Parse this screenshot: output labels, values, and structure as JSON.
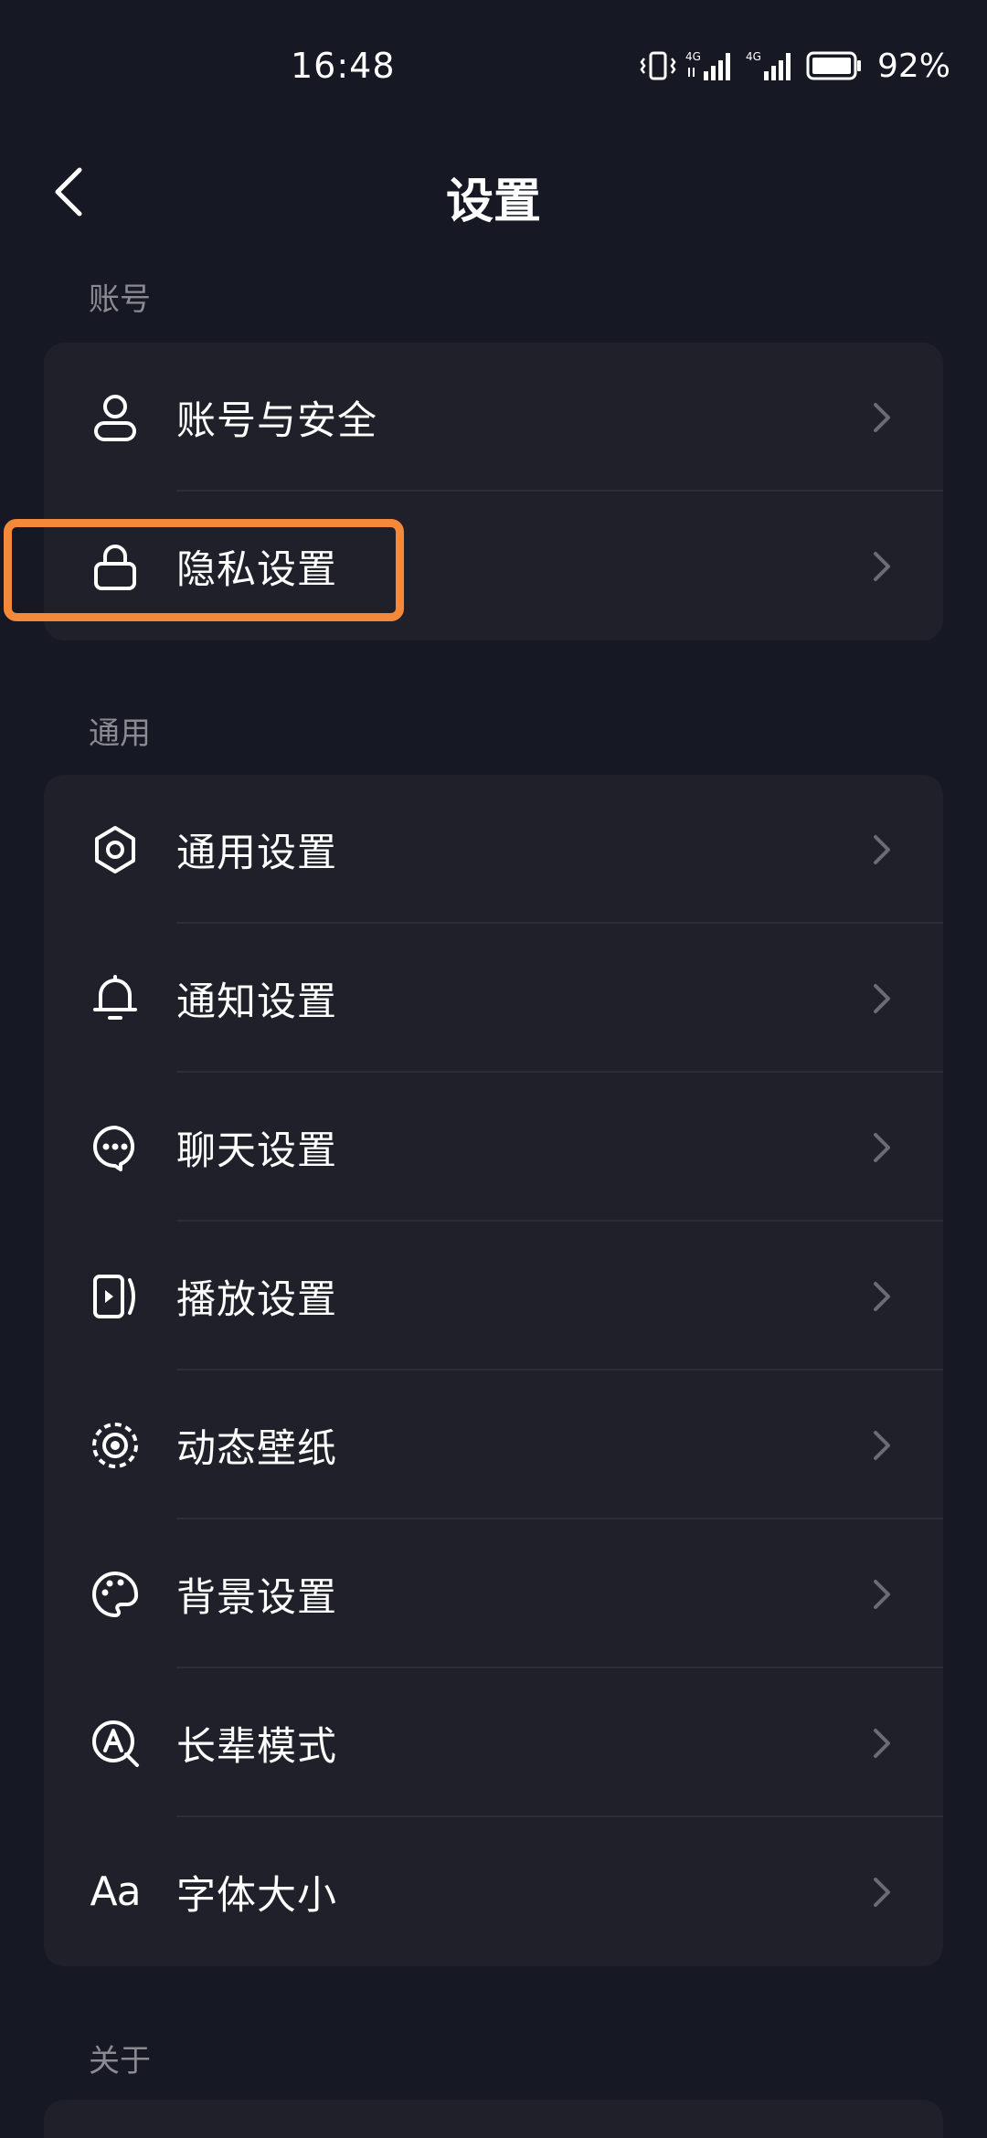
{
  "status_bar": {
    "time": "16:48",
    "battery": "92%",
    "network_1": "4G",
    "network_2": "4G"
  },
  "header": {
    "title": "设置"
  },
  "sections": {
    "account": {
      "label": "账号",
      "items": [
        {
          "label": "账号与安全",
          "icon": "user-icon"
        },
        {
          "label": "隐私设置",
          "icon": "lock-icon"
        }
      ]
    },
    "general": {
      "label": "通用",
      "items": [
        {
          "label": "通用设置",
          "icon": "gear-icon"
        },
        {
          "label": "通知设置",
          "icon": "bell-icon"
        },
        {
          "label": "聊天设置",
          "icon": "chat-bubble-icon"
        },
        {
          "label": "播放设置",
          "icon": "play-icon"
        },
        {
          "label": "动态壁纸",
          "icon": "live-wallpaper-icon"
        },
        {
          "label": "背景设置",
          "icon": "palette-icon"
        },
        {
          "label": "长辈模式",
          "icon": "elder-mode-icon"
        },
        {
          "label": "字体大小",
          "icon": "font-size-icon",
          "icon_text": "Aa"
        }
      ]
    },
    "about": {
      "label": "关于"
    }
  },
  "colors": {
    "background": "#161823",
    "card": "#1f2029",
    "highlight": "#f5893a",
    "muted_text": "#8a8b91"
  }
}
